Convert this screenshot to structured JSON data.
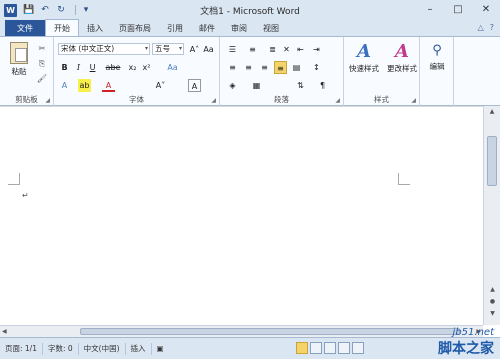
{
  "window": {
    "app_icon": "W",
    "title": "文档1 - Microsoft Word",
    "controls": [
      "–",
      "□",
      "✕"
    ]
  },
  "qat": {
    "save_icon": "💾",
    "undo_icon": "↶",
    "redo_icon": "↻",
    "customize_icon": "▾"
  },
  "tabs": {
    "file": "文件",
    "items": [
      "开始",
      "插入",
      "页面布局",
      "引用",
      "邮件",
      "审阅",
      "视图"
    ],
    "active": "开始",
    "right_icons": [
      "△",
      "?"
    ]
  },
  "ribbon": {
    "clipboard": {
      "label": "剪贴板",
      "paste": "粘贴",
      "cut": "✂",
      "copy": "⎘",
      "format_painter": "🖌"
    },
    "font": {
      "label": "字体",
      "font_name": "宋体 (中文正文)",
      "font_size": "五号",
      "buttons": [
        "B",
        "I",
        "U",
        "abe",
        "x₂",
        "x²"
      ],
      "grow": "A˄",
      "shrink": "A˅",
      "color": "A",
      "clear": "Aa"
    },
    "paragraph": {
      "label": "段落"
    },
    "styles": {
      "label": "样式",
      "quick": "快速样式",
      "change": "更改样式"
    },
    "editing": {
      "label": "编辑",
      "find": "编辑"
    }
  },
  "document": {
    "cursor": "↵"
  },
  "statusbar": {
    "page": "页面: 1/1",
    "words": "字数: 0",
    "lang": "中文(中国)",
    "mode": "插入"
  },
  "watermark": {
    "line1": "jb51.net",
    "line2": "脚本之家"
  }
}
